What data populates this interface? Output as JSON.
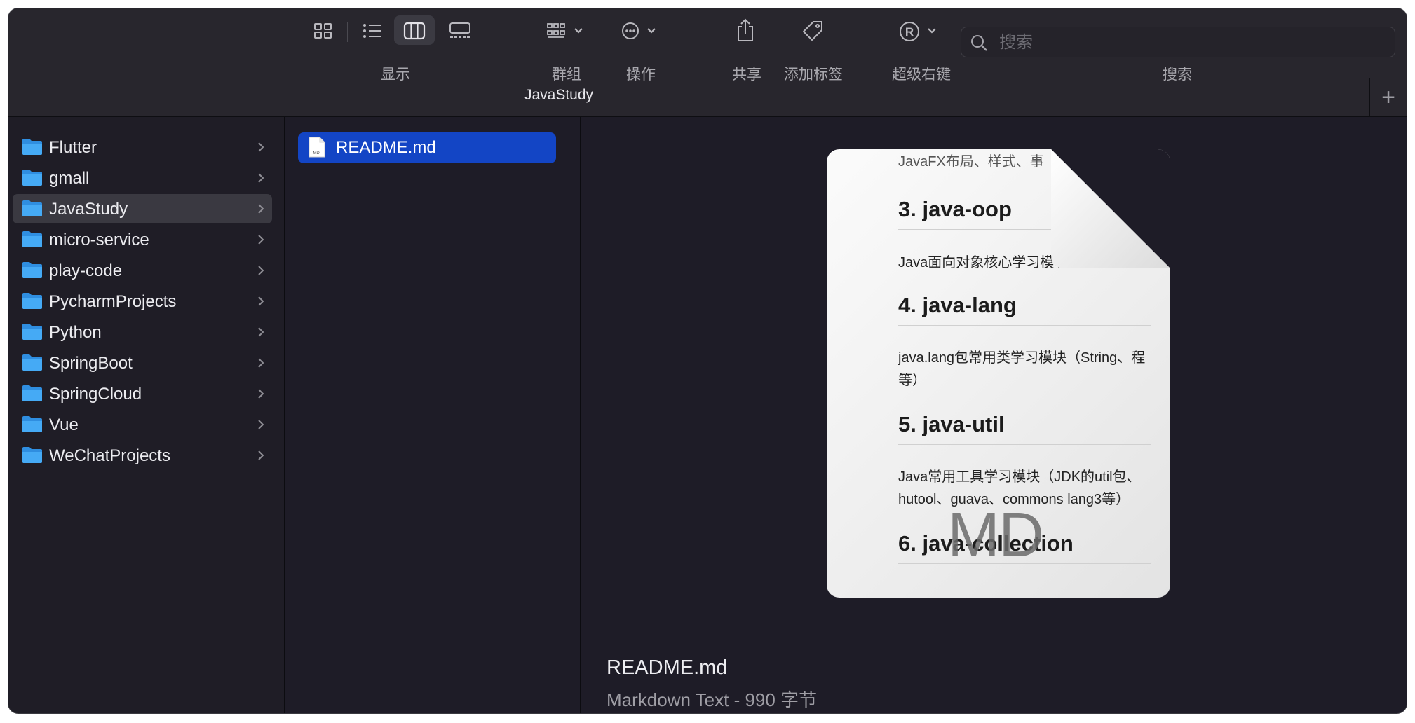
{
  "toolbar": {
    "view_label": "显示",
    "group_label": "群组",
    "action_label": "操作",
    "share_label": "共享",
    "tag_label": "添加标签",
    "superright_label": "超级右键",
    "search_label": "搜索",
    "search_placeholder": "搜索"
  },
  "window": {
    "title": "JavaStudy",
    "add_tab": "+"
  },
  "sidebar": {
    "items": [
      {
        "label": "Flutter"
      },
      {
        "label": "gmall"
      },
      {
        "label": "JavaStudy"
      },
      {
        "label": "micro-service"
      },
      {
        "label": "play-code"
      },
      {
        "label": "PycharmProjects"
      },
      {
        "label": "Python"
      },
      {
        "label": "SpringBoot"
      },
      {
        "label": "SpringCloud"
      },
      {
        "label": "Vue"
      },
      {
        "label": "WeChatProjects"
      }
    ],
    "selected_index": 2
  },
  "files": [
    {
      "name": "README.md",
      "icon_text": "MD"
    }
  ],
  "preview": {
    "doc": {
      "top_fragment": "JavaFX布局、样式、事",
      "h3": "3. java-oop",
      "p3": "Java面向对象核心学习模块",
      "h4": "4. java-lang",
      "p4": "java.lang包常用类学习模块（String、程等）",
      "h5": "5. java-util",
      "p5": "Java常用工具学习模块（JDK的util包、hutool、guava、commons lang3等）",
      "h6": "6. java-collection",
      "type_mark": "MD"
    },
    "file_name": "README.md",
    "file_info": "Markdown Text - 990 字节"
  },
  "colors": {
    "accent": "#1345c5",
    "folder": "#3aa0f0",
    "background": "#1e1c27"
  }
}
